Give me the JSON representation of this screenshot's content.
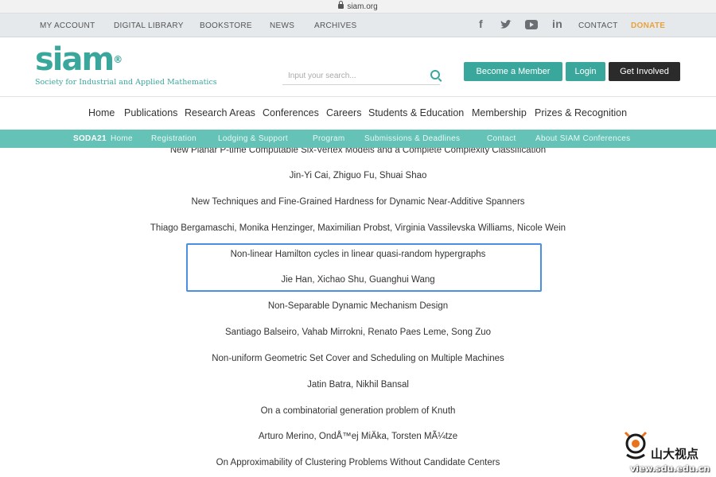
{
  "browser": {
    "url": "siam.org"
  },
  "topnav": {
    "links": [
      "MY ACCOUNT",
      "DIGITAL LIBRARY",
      "BOOKSTORE",
      "NEWS",
      "ARCHIVES"
    ],
    "social": [
      "facebook-icon",
      "twitter-icon",
      "youtube-icon",
      "linkedin-icon"
    ],
    "contact": "CONTACT",
    "donate": "DONATE"
  },
  "header": {
    "logo": "siam",
    "tagline": "Society for Industrial and Applied Mathematics",
    "search_placeholder": "Input your search...",
    "buttons": {
      "member": "Become a Member",
      "login": "Login",
      "involved": "Get Involved"
    }
  },
  "mainnav": [
    "Home",
    "Publications",
    "Research Areas",
    "Conferences",
    "Careers",
    "Students & Education",
    "Membership",
    "Prizes & Recognition"
  ],
  "subnav": {
    "brand": "SODA21",
    "items": [
      "Home",
      "Registration",
      "Lodging & Support",
      "Program",
      "Submissions & Deadlines",
      "Contact",
      "About SIAM Conferences"
    ]
  },
  "papers": [
    {
      "title": "New Planar P-time Computable Six-Vertex Models and a Complete Complexity Classification",
      "authors": "Jin-Yi Cai, Zhiguo Fu, Shuai Shao"
    },
    {
      "title": "New Techniques and Fine-Grained Hardness for Dynamic Near-Additive Spanners",
      "authors": "Thiago Bergamaschi, Monika Henzinger, Maximilian Probst, Virginia Vassilevska Williams, Nicole Wein"
    },
    {
      "title": "Non-linear Hamilton cycles in linear quasi-random hypergraphs",
      "authors": "Jie Han, Xichao Shu, Guanghui Wang"
    },
    {
      "title": "Non-Separable Dynamic Mechanism Design",
      "authors": "Santiago Balseiro, Vahab Mirrokni, Renato Paes Leme, Song Zuo"
    },
    {
      "title": "Non-uniform Geometric Set Cover and Scheduling on Multiple Machines",
      "authors": "Jatin Batra, Nikhil Bansal"
    },
    {
      "title": "On a combinatorial generation problem of Knuth",
      "authors": "Arturo Merino, OndÅ™ej MiÄka, Torsten MÃ¼tze"
    },
    {
      "title": "On Approximability of Clustering Problems Without Candidate Centers",
      "authors": ""
    }
  ],
  "watermark": {
    "text": "山大视点",
    "url": "view.sdu.edu.cn"
  },
  "colors": {
    "teal": "#3aa79c",
    "subnav": "#64c2b6",
    "donate": "#e9a23b",
    "highlight": "#4a90e2"
  }
}
